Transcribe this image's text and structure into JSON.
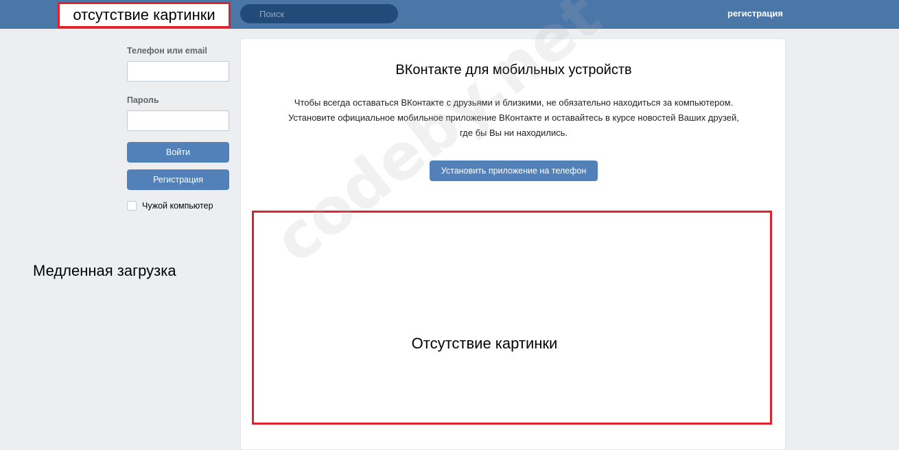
{
  "header": {
    "logo_placeholder": "отсутствие картинки",
    "search_placeholder": "Поиск",
    "register_link": "регистрация"
  },
  "login": {
    "phone_label": "Телефон или email",
    "password_label": "Пароль",
    "login_button": "Войти",
    "register_button": "Регистрация",
    "foreign_computer_label": "Чужой компьютер"
  },
  "main": {
    "title": "ВКонтакте для мобильных устройств",
    "description": "Чтобы всегда оставаться ВКонтакте с друзьями и близкими, не обязательно находиться за компьютером. Установите официальное мобильное приложение ВКонтакте и оставайтесь в курсе новостей Ваших друзей, где бы Вы ни находились.",
    "install_button": "Установить приложение на телефон",
    "missing_image_label": "Отсутствие картинки"
  },
  "annotations": {
    "slow_loading": "Медленная загрузка"
  },
  "watermark": "codeby.net",
  "colors": {
    "header_bg": "#4a76a8",
    "button_bg": "#5181b8",
    "highlight_border": "#e0212c",
    "page_bg": "#edeef0"
  }
}
